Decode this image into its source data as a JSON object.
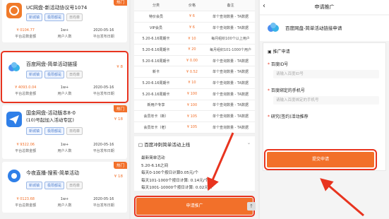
{
  "panel1": {
    "cards": [
      {
        "title": "UC网盘-新活动协议号1074",
        "title2": "",
        "hot": "热门",
        "price": "",
        "tags": [
          "新城镇",
          "极限都是",
          "日均单"
        ],
        "stats": [
          {
            "v": "¥ 0104.77",
            "l": "平台总数金额"
          },
          {
            "v": "1w+",
            "l": "用户人数"
          },
          {
            "v": "2020-05-16",
            "l": "平台发布日期"
          }
        ]
      },
      {
        "title": "百度网盘-简单活动链接",
        "title2": "",
        "hot": "热门",
        "price": "¥ 8",
        "tags": [
          "新城镇",
          "极限都是",
          "日均单"
        ],
        "stats": [
          {
            "v": "¥ 4093.0.04",
            "l": "平台总数金额"
          },
          {
            "v": "1w+",
            "l": "用户人数"
          },
          {
            "v": "2020-05-16",
            "l": "平台发布日期"
          }
        ]
      },
      {
        "title": "国金网盘-活动版本8-0",
        "title2": "(10)号起加入活动专区)",
        "hot": "热门",
        "price": "¥ 18",
        "tags": [
          "新城镇",
          "极限都是",
          "日均单"
        ],
        "stats": [
          {
            "v": "¥ 9322.06",
            "l": "平台总数金额"
          },
          {
            "v": "1w+",
            "l": "用户人数"
          },
          {
            "v": "2020-05-16",
            "l": "平台发布日期"
          }
        ]
      },
      {
        "title": "今夜直播-搜索-简单活动",
        "title2": "",
        "hot": "热门",
        "price": "¥ 18",
        "tags": [
          "新城镇",
          "极限都是",
          "日均单"
        ],
        "stats": [
          {
            "v": "¥ 0123.68",
            "l": "平台总数金额"
          },
          {
            "v": "1w+",
            "l": "用户人数"
          },
          {
            "v": "2020-05-16",
            "l": "平台发布日期"
          }
        ]
      }
    ]
  },
  "panel2": {
    "headers": [
      "分类",
      "价格",
      "备注"
    ],
    "rows": [
      [
        "特价会员",
        "¥ 6",
        "单个查询数量 - TA数据"
      ],
      [
        "VIP会员",
        "¥ 6",
        "单个查询数量 - TA数据"
      ],
      [
        "5.20-6.16周期卡",
        "¥ 10",
        "每月组织100个以上用户"
      ],
      [
        "5.20-6.16周期卡",
        "¥ 20",
        "每月组织101-1000个用户"
      ],
      [
        "5.20-6.16周期卡",
        "¥ 0.00",
        "单个查询数量 - TA数据"
      ],
      [
        "新卡",
        "¥ 0.52",
        "单个查询数量 - TA数据"
      ],
      [
        "5.20-6.16周期卡",
        "¥ 10",
        "单个查询数量 - TA数据"
      ],
      [
        "5.20-6.16周期卡",
        "¥ 100",
        "单个查询数量 - TA数据"
      ],
      [
        "新用户专享",
        "¥ 100",
        "单个查询数量 - TA数据"
      ],
      [
        "会员年卡（新）",
        "¥ 105",
        "单个查询数量 - TA数据"
      ],
      [
        "会员年卡（老）",
        "¥ 105",
        "单个查询数量 - TA数据"
      ]
    ],
    "section_title": "百度冲刺简单活动上线",
    "section_lines": [
      "最新简单活动",
      "5.20-6.16之间",
      "每天0-100个按日计算0.05元/个",
      "每天101-1000个按日计算: 0.14元/个",
      "每天1001-10000个按日计算: 0.02元/个"
    ],
    "button": "申请推广",
    "top_icon": "↑"
  },
  "panel3": {
    "nav_title": "申请推广",
    "back_icon": "‹",
    "app_name": "百度网盘-简单活动链接申请",
    "form_title": "推广申请",
    "fields": [
      {
        "label": "百度ID号",
        "placeholder": "请输入百度ID号"
      },
      {
        "label": "百度绑定的手机号",
        "placeholder": "请输入百度绑定的手机号"
      },
      {
        "label": "研究(签约)活动推荐",
        "placeholder": ""
      }
    ],
    "submit": "提交申请"
  },
  "colors": {
    "accent": "#f2702a",
    "highlight": "#e8341f"
  }
}
